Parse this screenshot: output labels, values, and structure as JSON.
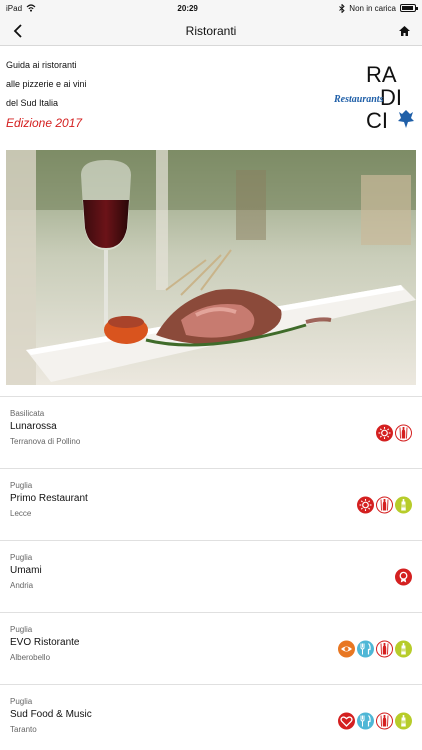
{
  "status": {
    "device": "iPad",
    "time": "20:29",
    "battery_text": "Non in carica",
    "battery_level": 0.9
  },
  "nav": {
    "title": "Ristoranti"
  },
  "banner": {
    "line1": "Guida ai ristoranti",
    "line2": "alle pizzerie e ai vini",
    "line3": "del Sud Italia",
    "edition": "Edizione 2017",
    "logo": {
      "top": "RA",
      "middle": "DI",
      "bottom": "CI",
      "script": "Restaurants"
    }
  },
  "colors": {
    "red": "#d42020",
    "cyan": "#4fb7d6",
    "orange": "#e87722",
    "lime": "#b7cc2a",
    "logo_blue": "#1f5fa8"
  },
  "restaurants": [
    {
      "region": "Basilicata",
      "name": "Lunarossa",
      "city": "Terranova di Pollino",
      "badges": [
        "sun-badge-icon",
        "wine-bottle-badge-icon"
      ]
    },
    {
      "region": "Puglia",
      "name": "Primo Restaurant",
      "city": "Lecce",
      "badges": [
        "sun-badge-icon",
        "wine-bottle-badge-icon",
        "oil-bottle-badge-icon"
      ]
    },
    {
      "region": "Puglia",
      "name": "Umami",
      "city": "Andria",
      "badges": [
        "award-badge-icon"
      ]
    },
    {
      "region": "Puglia",
      "name": "EVO Ristorante",
      "city": "Alberobello",
      "badges": [
        "eye-badge-icon",
        "cutlery-badge-icon",
        "wine-bottle-badge-icon",
        "oil-bottle-badge-icon"
      ]
    },
    {
      "region": "Puglia",
      "name": "Sud Food & Music",
      "city": "Taranto",
      "badges": [
        "heart-badge-icon",
        "cutlery-badge-icon",
        "wine-bottle-badge-icon",
        "oil-bottle-badge-icon"
      ]
    }
  ]
}
